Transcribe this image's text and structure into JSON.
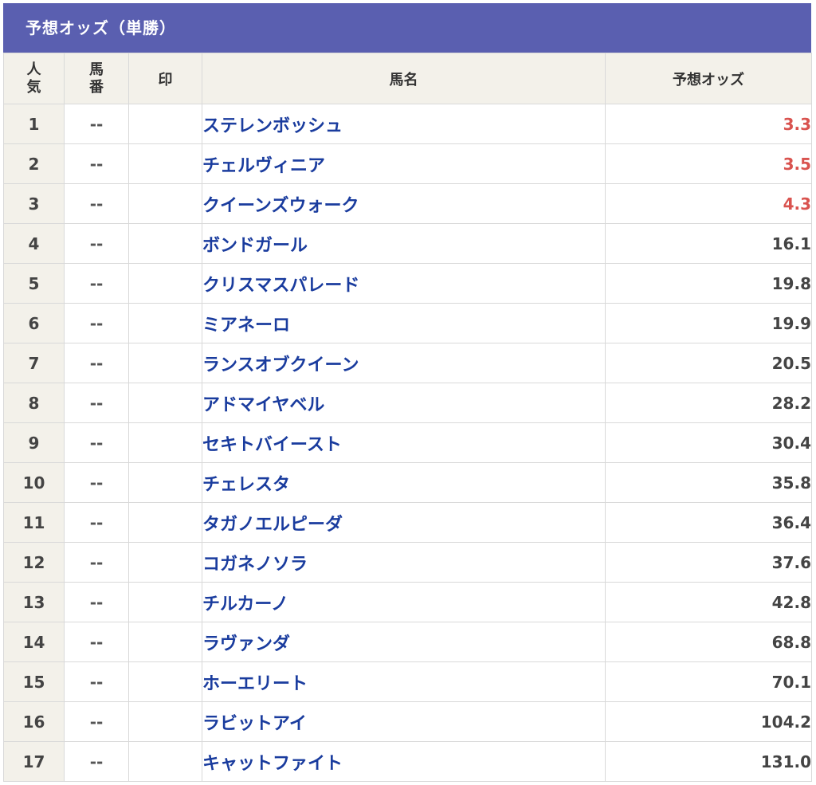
{
  "title": "予想オッズ（単勝）",
  "header": {
    "popularity_line1": "人",
    "popularity_line2": "気",
    "number_line1": "馬",
    "number_line2": "番",
    "mark": "印",
    "horse_name": "馬名",
    "odds": "予想オッズ"
  },
  "colors": {
    "title_bg": "#5a5fb0",
    "header_bg": "#f3f1ea",
    "horse_link": "#1a3c9e",
    "top_odds": "#d9534f"
  },
  "rows": [
    {
      "rank": "1",
      "num": "--",
      "mark": "",
      "name": "ステレンボッシュ",
      "odds": "3.3",
      "hot": true
    },
    {
      "rank": "2",
      "num": "--",
      "mark": "",
      "name": "チェルヴィニア",
      "odds": "3.5",
      "hot": true
    },
    {
      "rank": "3",
      "num": "--",
      "mark": "",
      "name": "クイーンズウォーク",
      "odds": "4.3",
      "hot": true
    },
    {
      "rank": "4",
      "num": "--",
      "mark": "",
      "name": "ボンドガール",
      "odds": "16.1",
      "hot": false
    },
    {
      "rank": "5",
      "num": "--",
      "mark": "",
      "name": "クリスマスパレード",
      "odds": "19.8",
      "hot": false
    },
    {
      "rank": "6",
      "num": "--",
      "mark": "",
      "name": "ミアネーロ",
      "odds": "19.9",
      "hot": false
    },
    {
      "rank": "7",
      "num": "--",
      "mark": "",
      "name": "ランスオブクイーン",
      "odds": "20.5",
      "hot": false
    },
    {
      "rank": "8",
      "num": "--",
      "mark": "",
      "name": "アドマイヤベル",
      "odds": "28.2",
      "hot": false
    },
    {
      "rank": "9",
      "num": "--",
      "mark": "",
      "name": "セキトバイースト",
      "odds": "30.4",
      "hot": false
    },
    {
      "rank": "10",
      "num": "--",
      "mark": "",
      "name": "チェレスタ",
      "odds": "35.8",
      "hot": false
    },
    {
      "rank": "11",
      "num": "--",
      "mark": "",
      "name": "タガノエルピーダ",
      "odds": "36.4",
      "hot": false
    },
    {
      "rank": "12",
      "num": "--",
      "mark": "",
      "name": "コガネノソラ",
      "odds": "37.6",
      "hot": false
    },
    {
      "rank": "13",
      "num": "--",
      "mark": "",
      "name": "チルカーノ",
      "odds": "42.8",
      "hot": false
    },
    {
      "rank": "14",
      "num": "--",
      "mark": "",
      "name": "ラヴァンダ",
      "odds": "68.8",
      "hot": false
    },
    {
      "rank": "15",
      "num": "--",
      "mark": "",
      "name": "ホーエリート",
      "odds": "70.1",
      "hot": false
    },
    {
      "rank": "16",
      "num": "--",
      "mark": "",
      "name": "ラビットアイ",
      "odds": "104.2",
      "hot": false
    },
    {
      "rank": "17",
      "num": "--",
      "mark": "",
      "name": "キャットファイト",
      "odds": "131.0",
      "hot": false
    }
  ]
}
